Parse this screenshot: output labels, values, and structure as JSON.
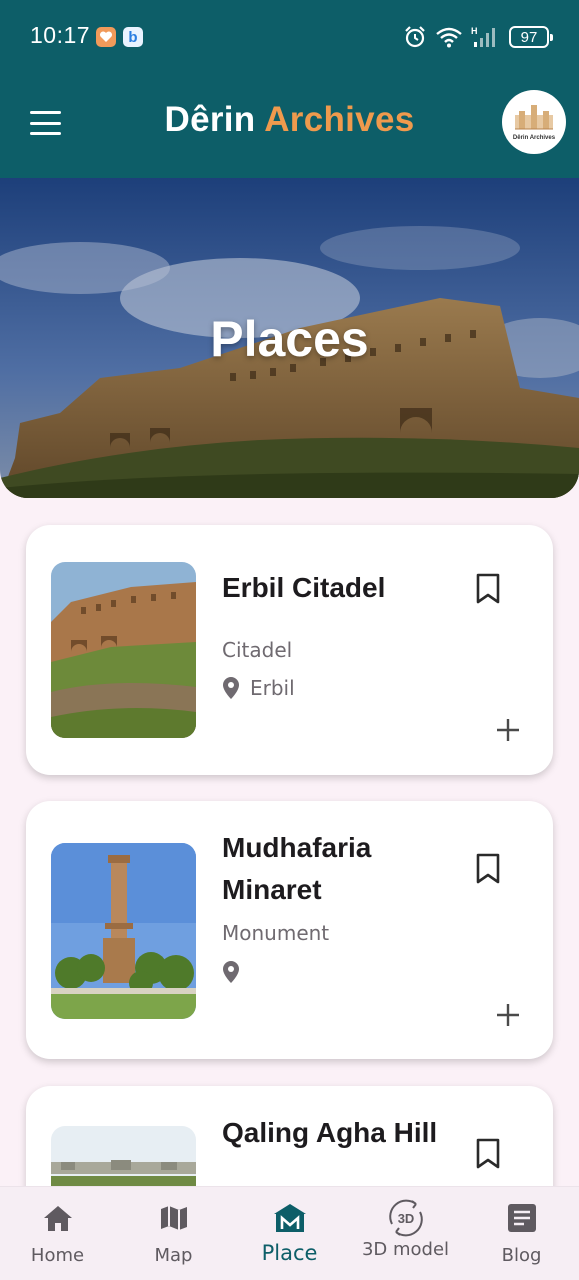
{
  "status_bar": {
    "time": "10:17",
    "battery": "97",
    "icons": [
      "alarm-icon",
      "wifi-icon",
      "signal-icon",
      "battery-icon"
    ]
  },
  "app_bar": {
    "title_part1": "Dêrin",
    "title_part2": "Archives",
    "logo_text": "Dêrin Archives",
    "colors": {
      "primary": "#0d5e68",
      "accent": "#ef9a4d"
    }
  },
  "hero": {
    "title": "Places"
  },
  "places": [
    {
      "name": "Erbil Citadel",
      "category": "Citadel",
      "location": "Erbil"
    },
    {
      "name": "Mudhafaria Minaret",
      "category": "Monument",
      "location": ""
    },
    {
      "name": "Qaling Agha Hill",
      "category": "",
      "location": ""
    }
  ],
  "bottom_nav": {
    "items": [
      {
        "label": "Home",
        "icon": "home-icon"
      },
      {
        "label": "Map",
        "icon": "map-icon"
      },
      {
        "label": "Place",
        "icon": "place-icon",
        "active": true
      },
      {
        "label": "3D model",
        "icon": "3d-model-icon"
      },
      {
        "label": "Blog",
        "icon": "blog-icon"
      }
    ]
  }
}
